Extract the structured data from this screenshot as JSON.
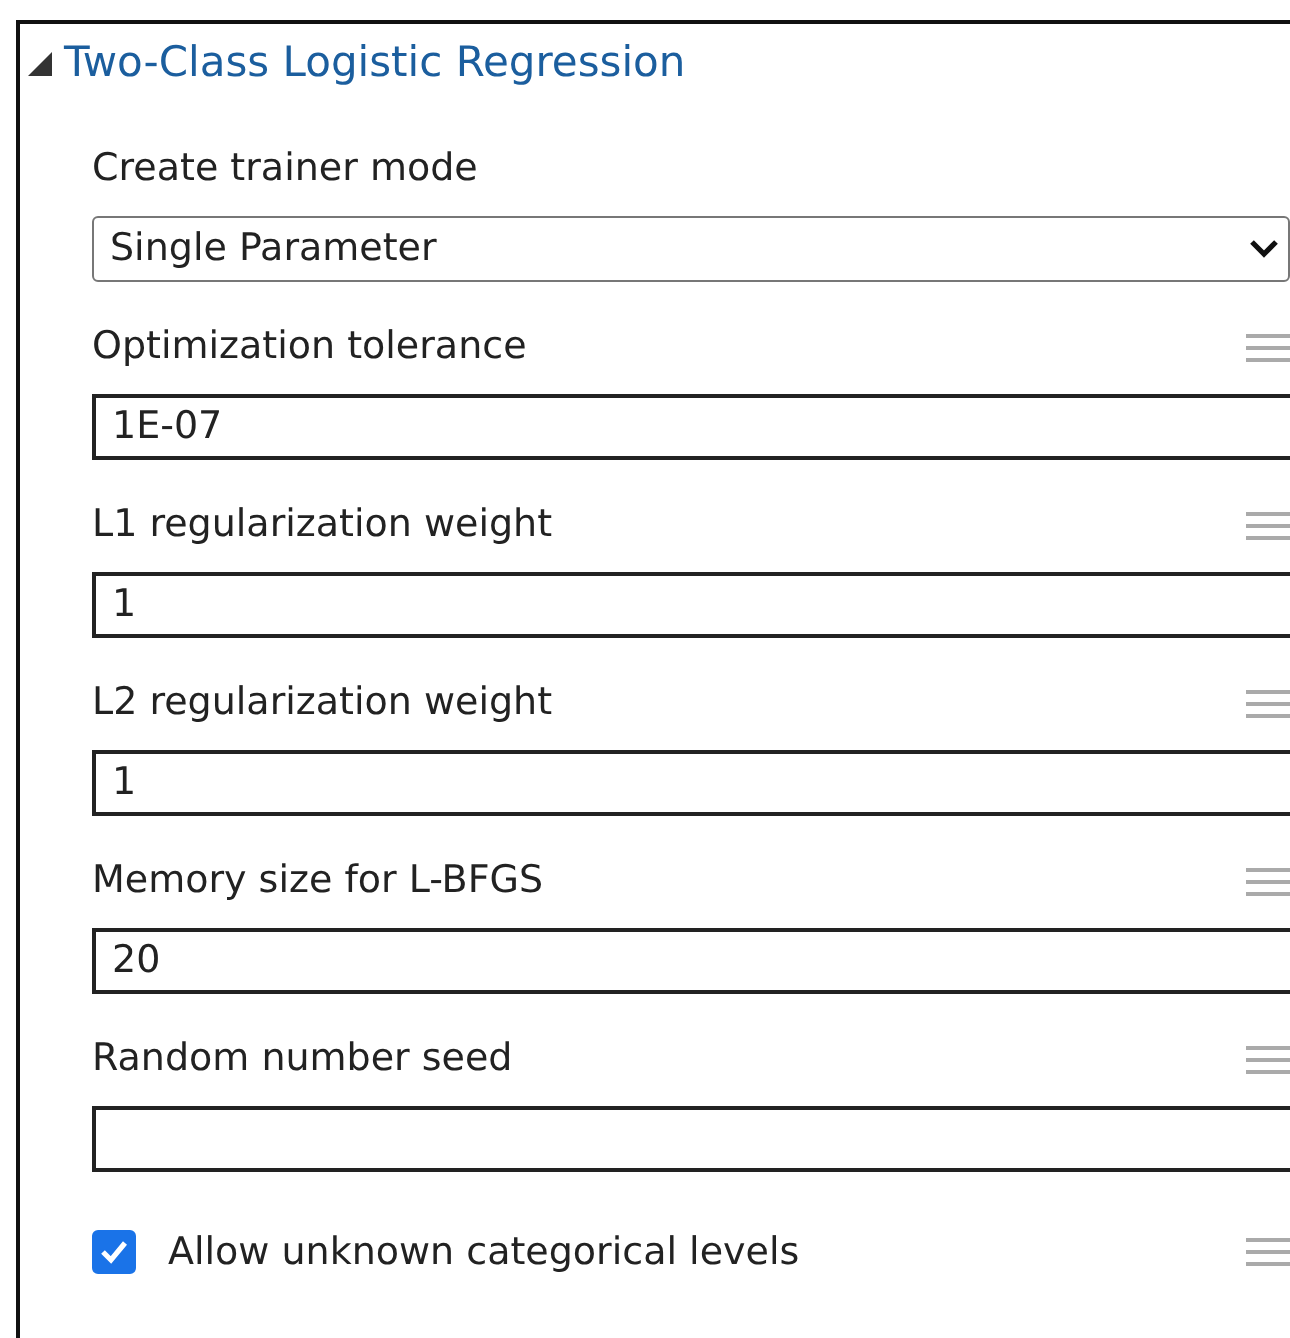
{
  "section": {
    "title": "Two-Class Logistic Regression",
    "expanded": true
  },
  "parameters": [
    {
      "kind": "select",
      "label": "Create trainer mode",
      "value": "Single Parameter"
    },
    {
      "kind": "text",
      "label": "Optimization tolerance",
      "value": "1E-07"
    },
    {
      "kind": "text",
      "label": "L1 regularization weight",
      "value": "1"
    },
    {
      "kind": "text",
      "label": "L2 regularization weight",
      "value": "1"
    },
    {
      "kind": "text",
      "label": "Memory size for L-BFGS",
      "value": "20"
    },
    {
      "kind": "text",
      "label": "Random number seed"
    },
    {
      "kind": "checkbox",
      "label": "Allow unknown categorical levels",
      "checked": true
    }
  ]
}
